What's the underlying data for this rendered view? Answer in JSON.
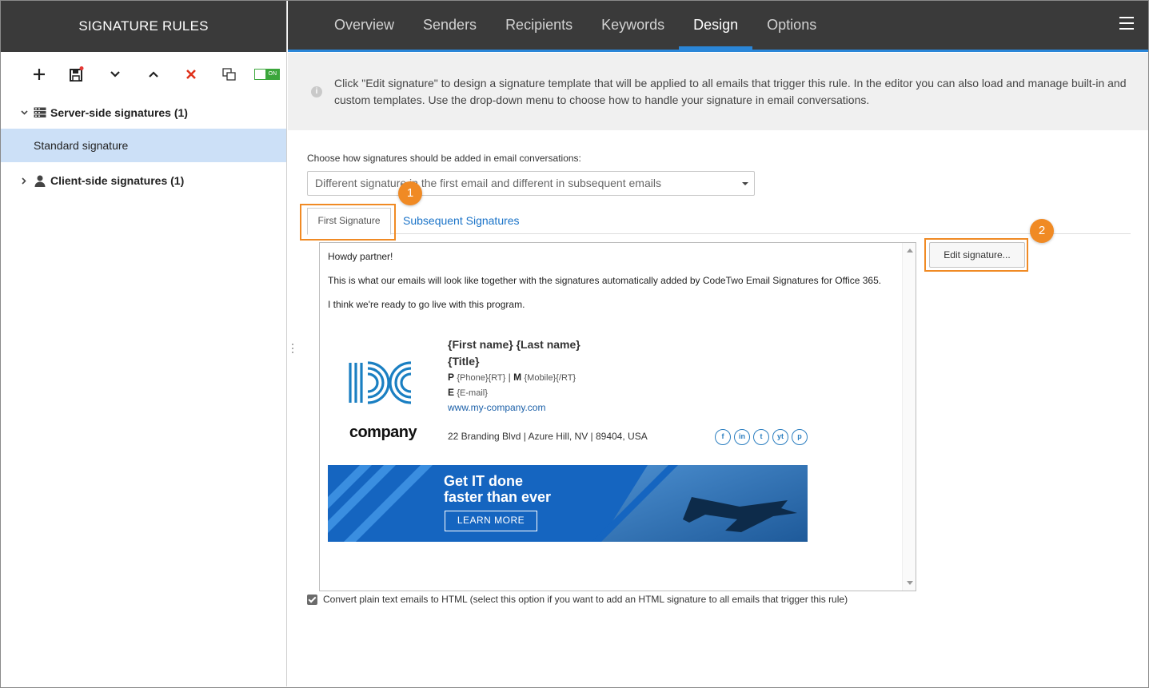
{
  "sidebar": {
    "title": "SIGNATURE RULES",
    "toolbar": {
      "add_icon": "plus-icon",
      "save_icon": "save-icon",
      "move_down_icon": "chevron-down-icon",
      "move_up_icon": "chevron-up-icon",
      "delete_icon": "close-icon",
      "copy_icon": "copy-icon",
      "toggle_label": "ON"
    },
    "groups": [
      {
        "label": "Server-side signatures (1)",
        "expanded": true,
        "icon": "server-icon",
        "items": [
          "Standard signature"
        ]
      },
      {
        "label": "Client-side signatures (1)",
        "expanded": false,
        "icon": "user-icon",
        "items": []
      }
    ],
    "selected_item": "Standard signature"
  },
  "nav": {
    "tabs": [
      "Overview",
      "Senders",
      "Recipients",
      "Keywords",
      "Design",
      "Options"
    ],
    "active_tab": "Design"
  },
  "info": {
    "text": "Click \"Edit signature\" to design a signature template that will be applied to all emails that trigger this rule. In the editor you can also load and manage built-in and custom templates. Use the drop-down menu to choose how to handle your signature in email conversations."
  },
  "main": {
    "conversation_label": "Choose how signatures should be added in email conversations:",
    "conversation_value": "Different signature in the first email and different in subsequent emails",
    "subtabs": [
      "First Signature",
      "Subsequent Signatures"
    ],
    "active_subtab": "First Signature",
    "edit_button": "Edit signature...",
    "badges": [
      "1",
      "2"
    ],
    "checkbox_label": "Convert plain text emails to HTML (select this option if you want to add an HTML signature to all emails that trigger this rule)",
    "checkbox_checked": true
  },
  "preview": {
    "greeting": "Howdy partner!",
    "body1": "This is what our emails will look like together with the signatures automatically added by CodeTwo Email Signatures for Office 365.",
    "body2": "I think we're ready to go live with this program.",
    "logo_word": "company",
    "name": "{First name} {Last name}",
    "title": "{Title}",
    "phone_label": "P",
    "phone_value": "{Phone}{RT}",
    "sep": "|",
    "mobile_label": "M",
    "mobile_value": "{Mobile}{/RT}",
    "email_label": "E",
    "email_value": "{E-mail}",
    "website": "www.my-company.com",
    "address": "22 Branding Blvd | Azure Hill, NV | 89404, USA",
    "social": [
      "f",
      "in",
      "t",
      "yt",
      "p"
    ],
    "banner_line1": "Get IT done",
    "banner_line2": "faster than ever",
    "banner_button": "LEARN MORE"
  },
  "colors": {
    "header_bg": "#3a3a3a",
    "accent": "#2a86d8",
    "highlight": "#f08a24",
    "selected_row": "#cce0f7",
    "banner": "#1565c0"
  }
}
